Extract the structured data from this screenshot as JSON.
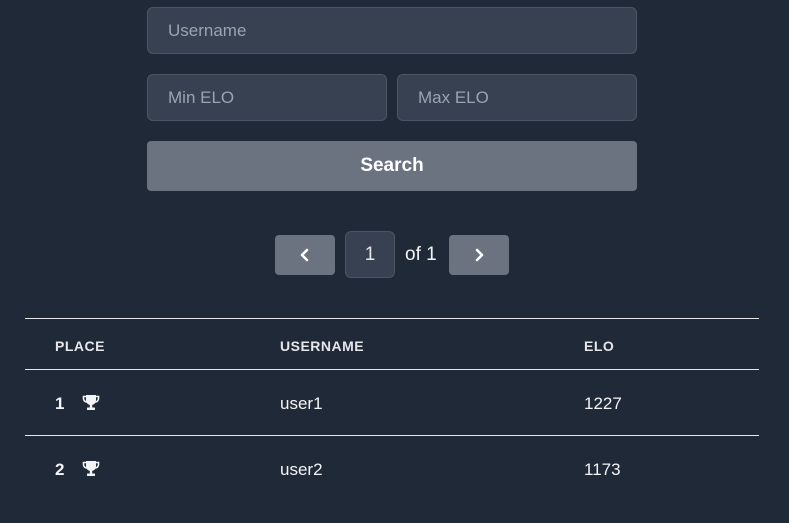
{
  "search": {
    "username_placeholder": "Username",
    "min_elo_placeholder": "Min ELO",
    "max_elo_placeholder": "Max ELO",
    "button_label": "Search"
  },
  "pagination": {
    "current_page": "1",
    "of_label": "of 1",
    "prev_icon": "chevron-left-icon",
    "next_icon": "chevron-right-icon"
  },
  "table": {
    "headers": {
      "place": "PLACE",
      "username": "USERNAME",
      "elo": "ELO"
    },
    "rows": [
      {
        "place": "1",
        "username": "user1",
        "elo": "1227",
        "icon": "trophy-icon"
      },
      {
        "place": "2",
        "username": "user2",
        "elo": "1173",
        "icon": "trophy-icon"
      }
    ]
  },
  "colors": {
    "background": "#1f2937",
    "input_bg": "#374151",
    "button_bg": "#6b7280"
  }
}
